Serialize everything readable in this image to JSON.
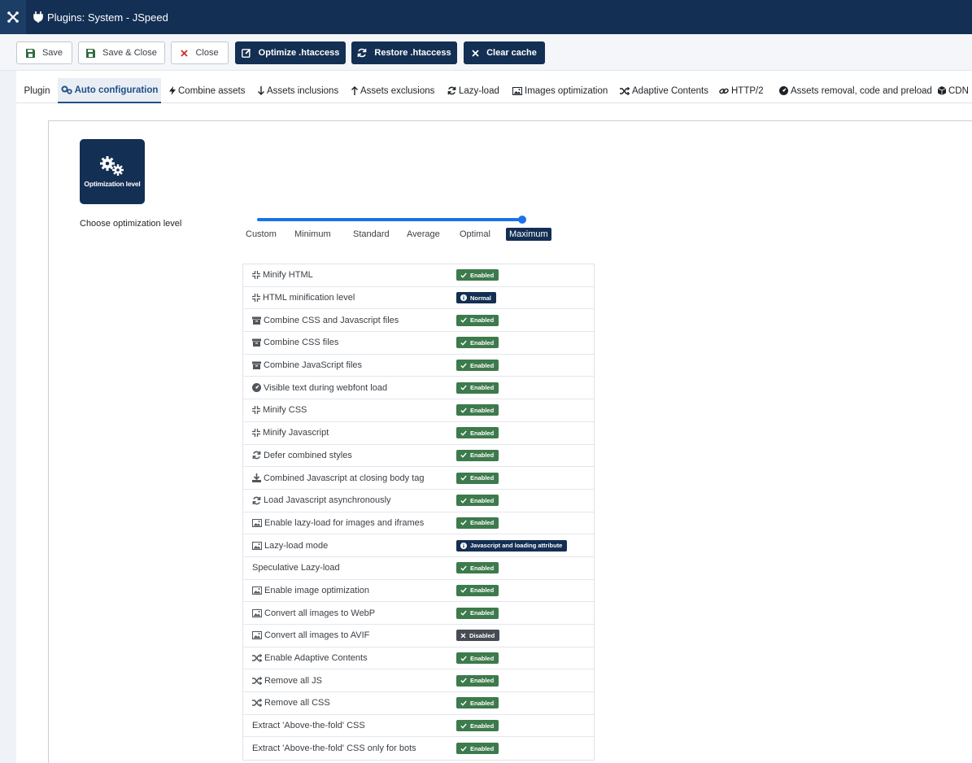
{
  "app": {
    "title": "Plugins: System - JSpeed"
  },
  "toolbar": {
    "save": "Save",
    "save_close": "Save & Close",
    "close": "Close",
    "optimize_htaccess": "Optimize .htaccess",
    "restore_htaccess": "Restore .htaccess",
    "clear_cache": "Clear cache"
  },
  "tabs": [
    {
      "label": "Plugin",
      "icon": "none"
    },
    {
      "label": "Auto configuration",
      "icon": "gears-icon"
    },
    {
      "label": "Combine assets",
      "icon": "bolt-icon"
    },
    {
      "label": "Assets inclusions",
      "icon": "arrow-down-icon"
    },
    {
      "label": "Assets exclusions",
      "icon": "arrow-up-icon"
    },
    {
      "label": "Lazy-load",
      "icon": "refresh-icon"
    },
    {
      "label": "Images optimization",
      "icon": "image-icon"
    },
    {
      "label": "Adaptive Contents",
      "icon": "shuffle-icon"
    },
    {
      "label": "HTTP/2",
      "icon": "link-icon"
    },
    {
      "label": "Assets removal, code and preload",
      "icon": "gauge-icon"
    },
    {
      "label": "CDN",
      "icon": "cube-icon"
    }
  ],
  "active_tab": "Auto configuration",
  "optimization": {
    "icon_label": "Optimization level",
    "choose_label": "Choose optimization level",
    "levels": [
      "Custom",
      "Minimum",
      "Standard",
      "Average",
      "Optimal",
      "Maximum"
    ],
    "selected": "Maximum",
    "slider_value": 1.0
  },
  "colors": {
    "enabled": "#3d7a4c",
    "info": "#132f53",
    "disabled": "#474c54",
    "accent": "#1a73e8"
  },
  "settings": [
    {
      "label": "Minify HTML",
      "icon": "compress-icon",
      "status": "Enabled",
      "type": "enabled"
    },
    {
      "label": "HTML minification level",
      "icon": "compress-icon",
      "status": "Normal",
      "type": "info"
    },
    {
      "label": "Combine CSS and Javascript files",
      "icon": "archive-icon",
      "status": "Enabled",
      "type": "enabled"
    },
    {
      "label": "Combine CSS files",
      "icon": "archive-icon",
      "status": "Enabled",
      "type": "enabled"
    },
    {
      "label": "Combine JavaScript files",
      "icon": "archive-icon",
      "status": "Enabled",
      "type": "enabled"
    },
    {
      "label": "Visible text during webfont load",
      "icon": "gauge-icon",
      "status": "Enabled",
      "type": "enabled"
    },
    {
      "label": "Minify CSS",
      "icon": "compress-icon",
      "status": "Enabled",
      "type": "enabled"
    },
    {
      "label": "Minify Javascript",
      "icon": "compress-icon",
      "status": "Enabled",
      "type": "enabled"
    },
    {
      "label": "Defer combined styles",
      "icon": "refresh-icon",
      "status": "Enabled",
      "type": "enabled"
    },
    {
      "label": "Combined Javascript at closing body tag",
      "icon": "download-icon",
      "status": "Enabled",
      "type": "enabled"
    },
    {
      "label": "Load Javascript asynchronously",
      "icon": "refresh-icon",
      "status": "Enabled",
      "type": "enabled"
    },
    {
      "label": "Enable lazy-load for images and iframes",
      "icon": "image-icon",
      "status": "Enabled",
      "type": "enabled"
    },
    {
      "label": "Lazy-load mode",
      "icon": "image-icon",
      "status": "Javascript and loading attribute",
      "type": "info"
    },
    {
      "label": "Speculative Lazy-load",
      "icon": "none",
      "status": "Enabled",
      "type": "enabled"
    },
    {
      "label": "Enable image optimization",
      "icon": "image-icon",
      "status": "Enabled",
      "type": "enabled"
    },
    {
      "label": "Convert all images to WebP",
      "icon": "image-icon",
      "status": "Enabled",
      "type": "enabled"
    },
    {
      "label": "Convert all images to AVIF",
      "icon": "image-icon",
      "status": "Disabled",
      "type": "disabled"
    },
    {
      "label": "Enable Adaptive Contents",
      "icon": "shuffle-icon",
      "status": "Enabled",
      "type": "enabled"
    },
    {
      "label": "Remove all JS",
      "icon": "shuffle-icon",
      "status": "Enabled",
      "type": "enabled"
    },
    {
      "label": "Remove all CSS",
      "icon": "shuffle-icon",
      "status": "Enabled",
      "type": "enabled"
    },
    {
      "label": "Extract 'Above-the-fold' CSS",
      "icon": "none",
      "status": "Enabled",
      "type": "enabled"
    },
    {
      "label": "Extract 'Above-the-fold' CSS only for bots",
      "icon": "none",
      "status": "Enabled",
      "type": "enabled"
    }
  ]
}
